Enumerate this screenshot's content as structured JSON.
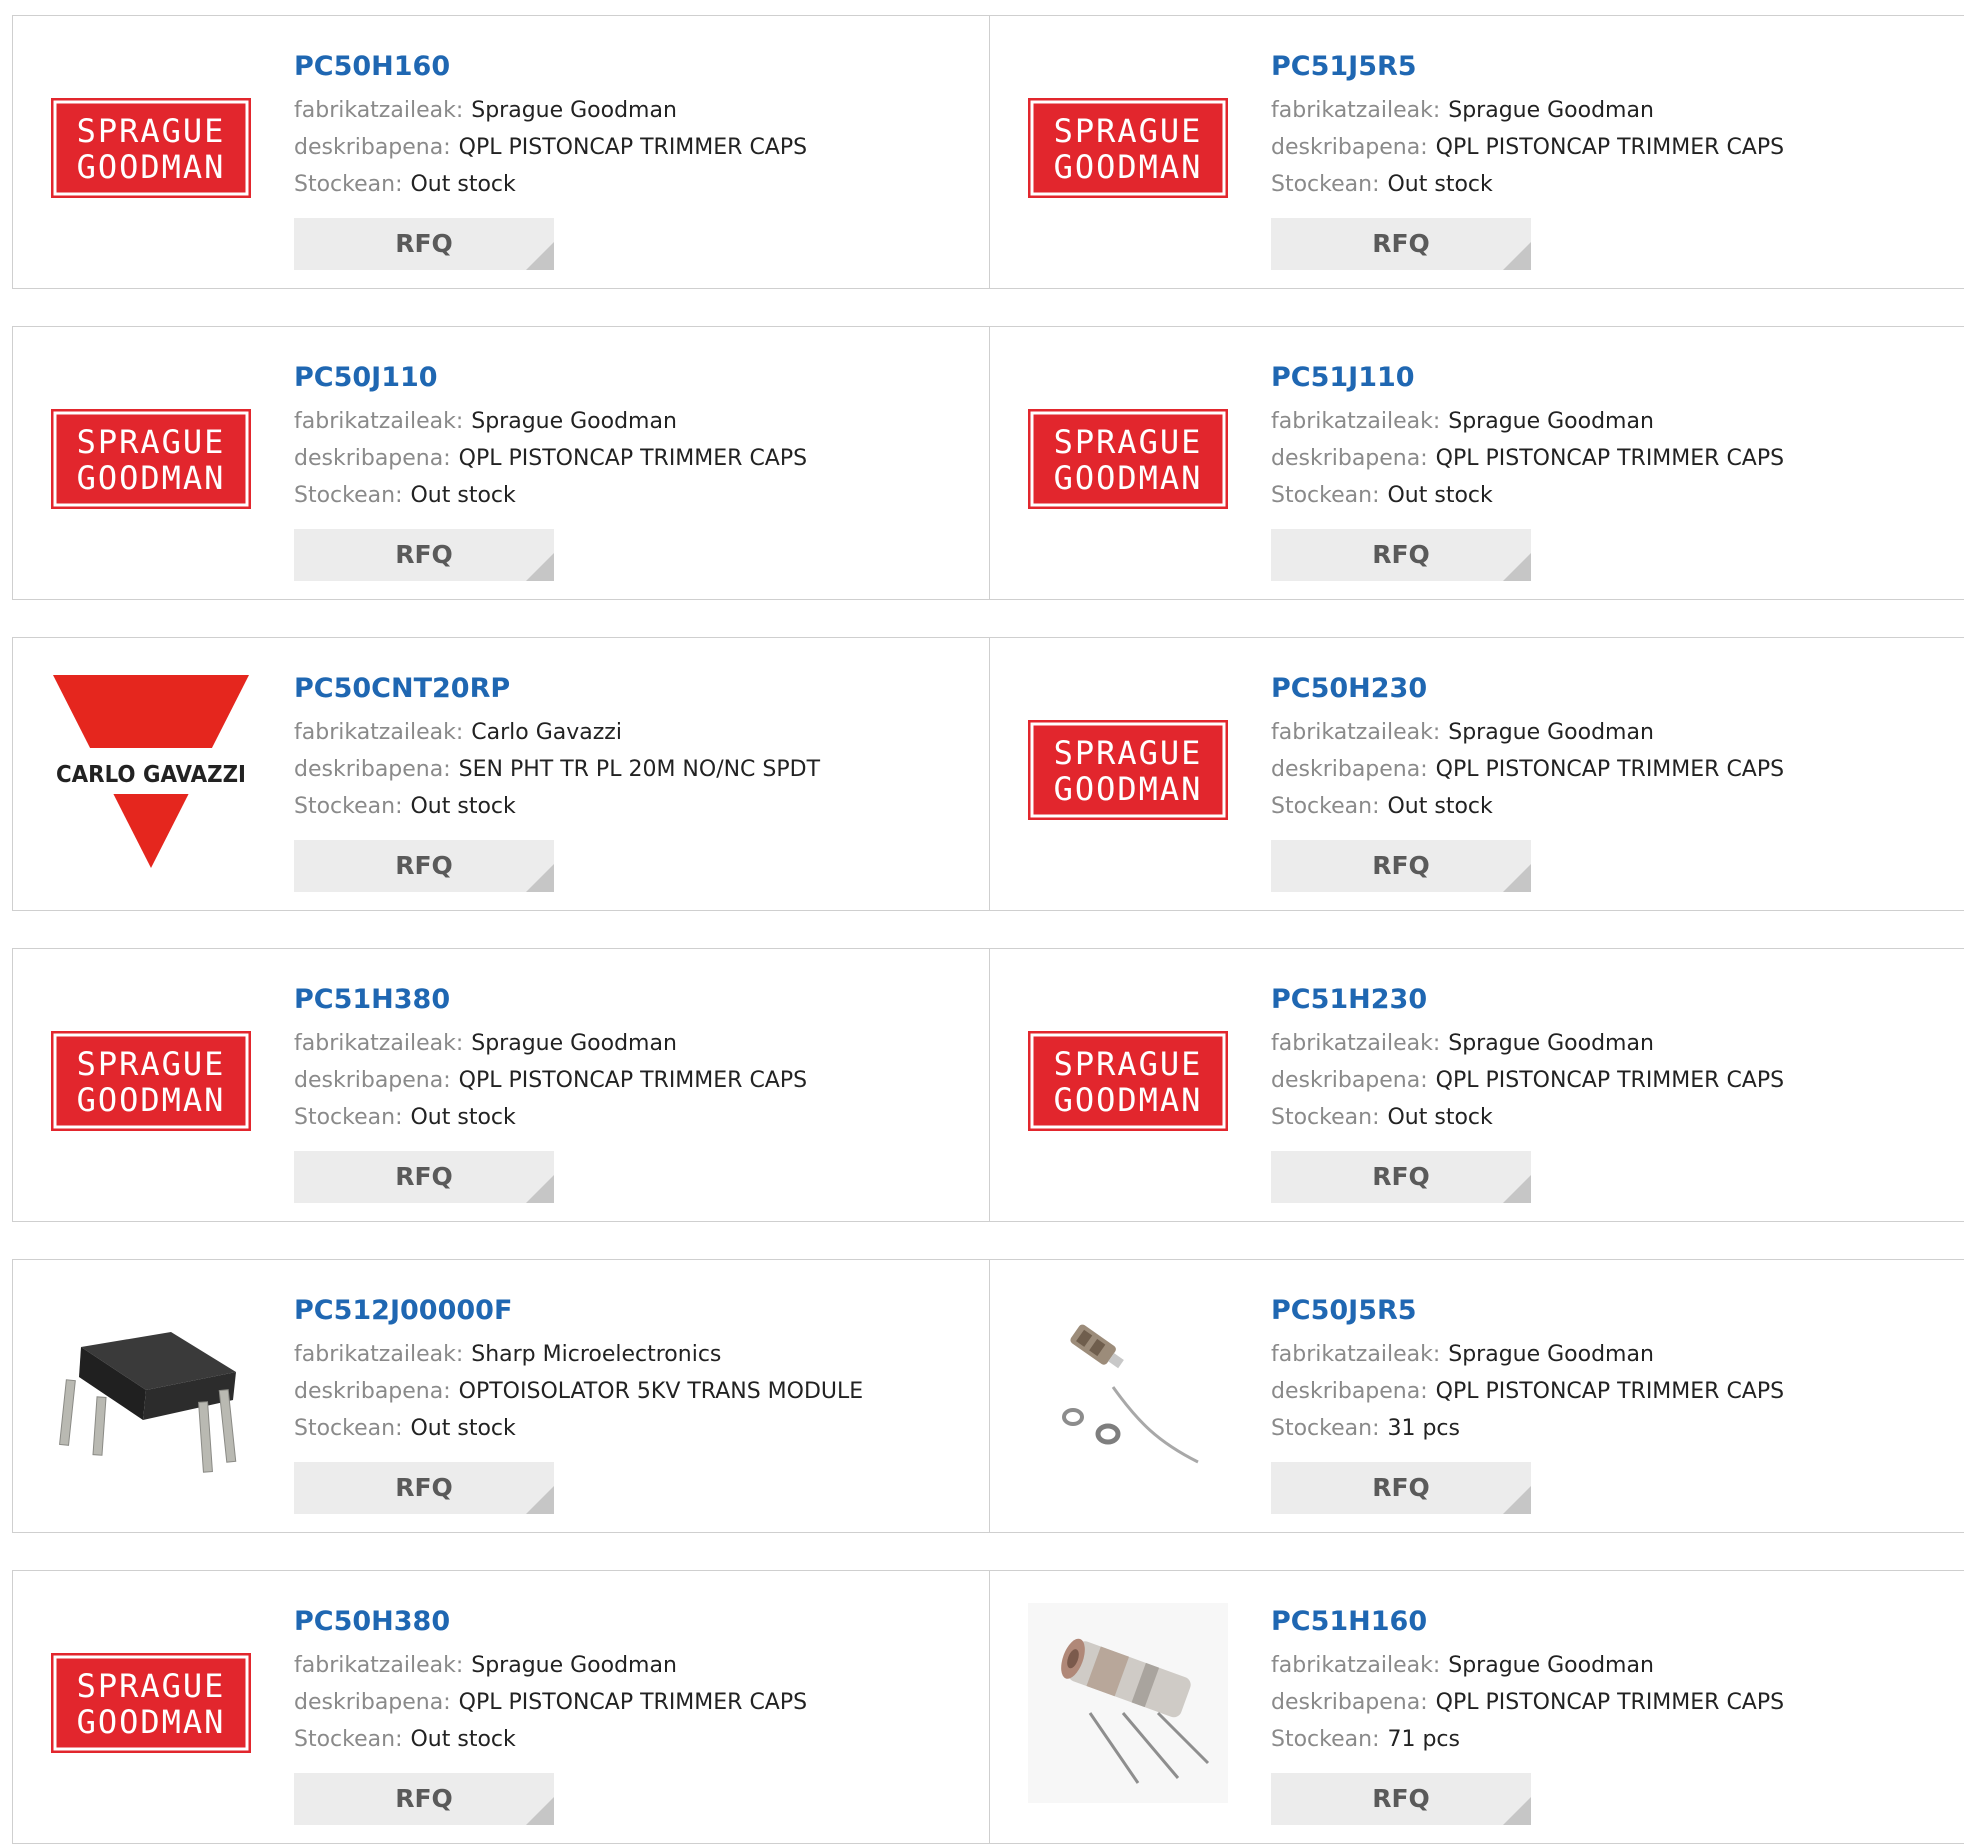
{
  "labels": {
    "manufacturer": "fabrikatzaileak:",
    "description": "deskribapena:",
    "stock": "Stockean:",
    "rfq": "RFQ"
  },
  "logos": {
    "sprague": {
      "line1": "SPRAGUE",
      "line2": "GOODMAN"
    },
    "carlo": {
      "text": "CARLO GAVAZZI"
    }
  },
  "colors": {
    "link": "#1f67b2",
    "sprague_red": "#e2262d",
    "carlo_red": "#e5261e"
  },
  "products": [
    {
      "part": "PC50H160",
      "manufacturer": "Sprague Goodman",
      "description": "QPL PISTONCAP TRIMMER CAPS",
      "stock": "Out stock",
      "image": "sprague-goodman-logo"
    },
    {
      "part": "PC51J5R5",
      "manufacturer": "Sprague Goodman",
      "description": "QPL PISTONCAP TRIMMER CAPS",
      "stock": "Out stock",
      "image": "sprague-goodman-logo"
    },
    {
      "part": "PC50J110",
      "manufacturer": "Sprague Goodman",
      "description": "QPL PISTONCAP TRIMMER CAPS",
      "stock": "Out stock",
      "image": "sprague-goodman-logo"
    },
    {
      "part": "PC51J110",
      "manufacturer": "Sprague Goodman",
      "description": "QPL PISTONCAP TRIMMER CAPS",
      "stock": "Out stock",
      "image": "sprague-goodman-logo"
    },
    {
      "part": "PC50CNT20RP",
      "manufacturer": "Carlo Gavazzi",
      "description": "SEN PHT TR PL 20M NO/NC SPDT",
      "stock": "Out stock",
      "image": "carlo-gavazzi-logo"
    },
    {
      "part": "PC50H230",
      "manufacturer": "Sprague Goodman",
      "description": "QPL PISTONCAP TRIMMER CAPS",
      "stock": "Out stock",
      "image": "sprague-goodman-logo"
    },
    {
      "part": "PC51H380",
      "manufacturer": "Sprague Goodman",
      "description": "QPL PISTONCAP TRIMMER CAPS",
      "stock": "Out stock",
      "image": "sprague-goodman-logo"
    },
    {
      "part": "PC51H230",
      "manufacturer": "Sprague Goodman",
      "description": "QPL PISTONCAP TRIMMER CAPS",
      "stock": "Out stock",
      "image": "sprague-goodman-logo"
    },
    {
      "part": "PC512J00000F",
      "manufacturer": "Sharp Microelectronics",
      "description": "OPTOISOLATOR 5KV TRANS MODULE",
      "stock": "Out stock",
      "image": "optoisolator-dip-photo"
    },
    {
      "part": "PC50J5R5",
      "manufacturer": "Sprague Goodman",
      "description": "QPL PISTONCAP TRIMMER CAPS",
      "stock": "31 pcs",
      "image": "trimmer-cap-hardware-photo"
    },
    {
      "part": "PC50H380",
      "manufacturer": "Sprague Goodman",
      "description": "QPL PISTONCAP TRIMMER CAPS",
      "stock": "Out stock",
      "image": "sprague-goodman-logo"
    },
    {
      "part": "PC51H160",
      "manufacturer": "Sprague Goodman",
      "description": "QPL PISTONCAP TRIMMER CAPS",
      "stock": "71 pcs",
      "image": "trimmer-cap-photo"
    }
  ]
}
